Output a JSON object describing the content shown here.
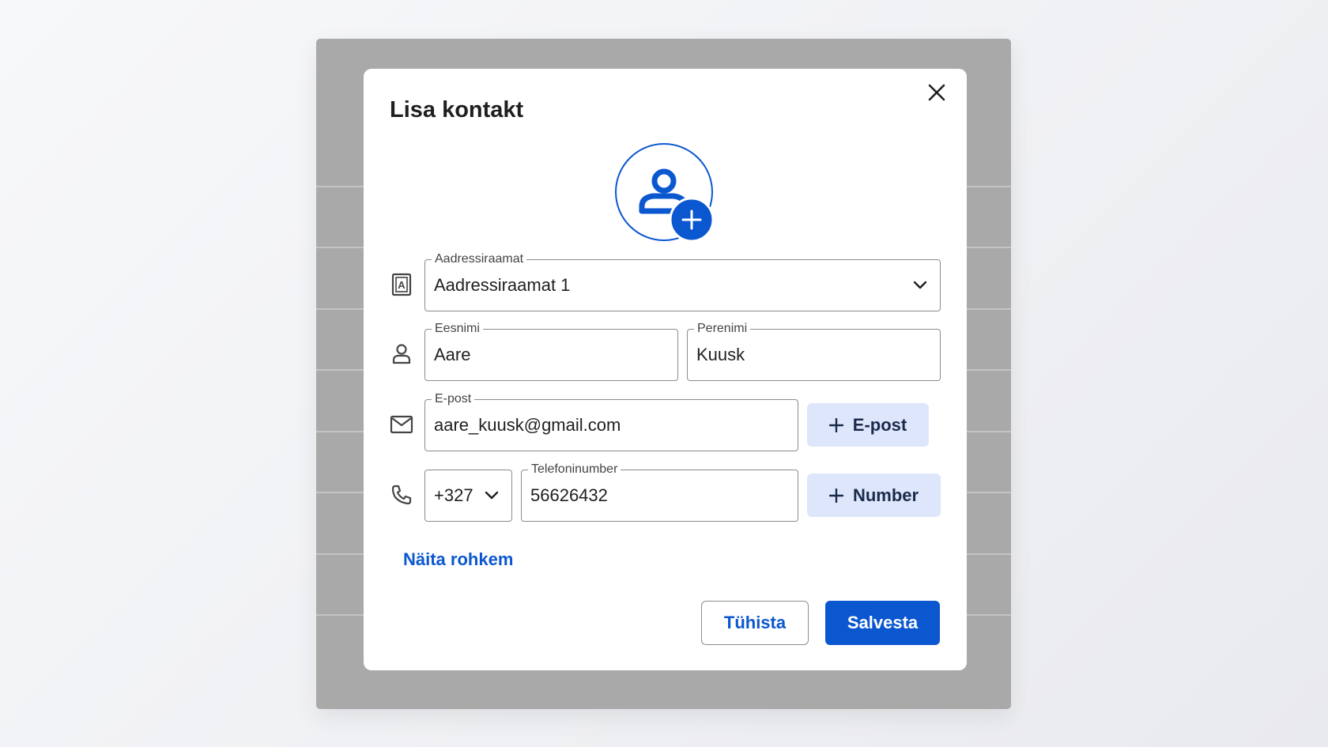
{
  "dialog": {
    "title": "Lisa kontakt",
    "close_icon": "close-icon"
  },
  "avatar": {
    "icon": "person-add-icon",
    "accent_color": "#0b57d0"
  },
  "address_book": {
    "label": "Aadressiraamat",
    "value": "Aadressiraamat 1",
    "icon": "contact-book-icon"
  },
  "first_name": {
    "label": "Eesnimi",
    "value": "Aare"
  },
  "last_name": {
    "label": "Perenimi",
    "value": "Kuusk"
  },
  "email": {
    "label": "E-post",
    "value": "aare_kuusk@gmail.com",
    "add_label": "E-post",
    "icon": "mail-icon"
  },
  "phone": {
    "country_code": "+327",
    "label": "Telefoninumber",
    "value": "56626432",
    "add_label": "Number",
    "icon": "phone-icon"
  },
  "show_more": "Näita rohkem",
  "actions": {
    "cancel_label": "Tühista",
    "save_label": "Salvesta"
  },
  "colors": {
    "primary": "#0b57d0",
    "tonal_button": "#dde6fb",
    "backdrop": "#a9a9a9"
  }
}
